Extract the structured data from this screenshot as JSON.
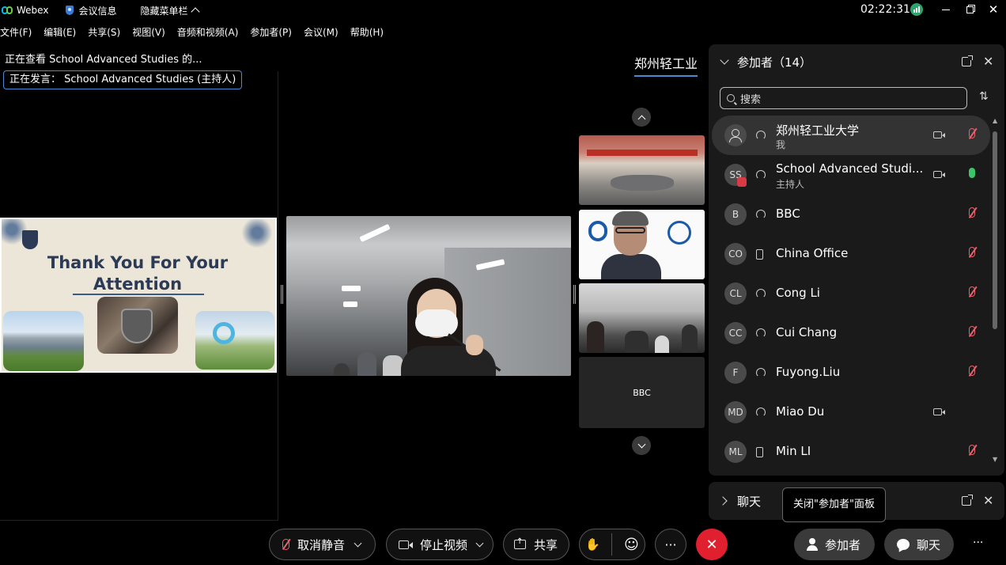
{
  "titlebar": {
    "app_name": "Webex",
    "meeting_info": "会议信息",
    "hide_menu": "隐藏菜单栏",
    "time": "02:22:31",
    "close_glyph": "✕",
    "accent": "#00bceb"
  },
  "menu": {
    "items": [
      "文件(F)",
      "编辑(E)",
      "共享(S)",
      "视图(V)",
      "音频和视频(A)",
      "参加者(P)",
      "会议(M)",
      "帮助(H)"
    ]
  },
  "share": {
    "viewing": "正在查看 School Advanced Studies 的...",
    "speaking": "正在发言： School Advanced Studies (主持人)",
    "slide_title": "Thank You For Your Attention"
  },
  "video_strip": {
    "self_name": "郑州轻工业",
    "thumb_label": "BBC"
  },
  "participants": {
    "title": "参加者（14）",
    "search_placeholder": "搜索",
    "sort_glyph": "⇅",
    "close_glyph": "✕",
    "items": [
      {
        "initials": "",
        "name": "郑州轻工业大学",
        "subtitle": "我",
        "connection": "computer",
        "video": true,
        "mic": "muted"
      },
      {
        "initials": "SS",
        "name": "School Advanced Studi...",
        "subtitle": "主持人",
        "connection": "computer",
        "video": true,
        "mic": "active"
      },
      {
        "initials": "B",
        "name": "BBC",
        "subtitle": "",
        "connection": "computer",
        "video": false,
        "mic": "muted"
      },
      {
        "initials": "CO",
        "name": "China Office",
        "subtitle": "",
        "connection": "phone",
        "video": false,
        "mic": "muted"
      },
      {
        "initials": "CL",
        "name": "Cong Li",
        "subtitle": "",
        "connection": "computer",
        "video": false,
        "mic": "muted"
      },
      {
        "initials": "CC",
        "name": "Cui Chang",
        "subtitle": "",
        "connection": "computer",
        "video": false,
        "mic": "muted"
      },
      {
        "initials": "F",
        "name": "Fuyong.Liu",
        "subtitle": "",
        "connection": "computer",
        "video": false,
        "mic": "muted"
      },
      {
        "initials": "MD",
        "name": "Miao Du",
        "subtitle": "",
        "connection": "computer",
        "video": true,
        "mic": "none"
      },
      {
        "initials": "ML",
        "name": "Min LI",
        "subtitle": "",
        "connection": "phone",
        "video": false,
        "mic": "muted"
      }
    ]
  },
  "chat": {
    "title": "聊天",
    "close_glyph": "✕",
    "tooltip": "关闭\"参加者\"面板"
  },
  "toolbar": {
    "unmute": "取消静音",
    "stop_video": "停止视频",
    "share": "共享",
    "raise_hand_glyph": "✋",
    "reactions_glyph": "☺",
    "more_glyph": "···",
    "leave_glyph": "✕",
    "participants": "参加者",
    "chat": "聊天",
    "overflow_glyph": "···",
    "leave_color": "#e0202e"
  }
}
